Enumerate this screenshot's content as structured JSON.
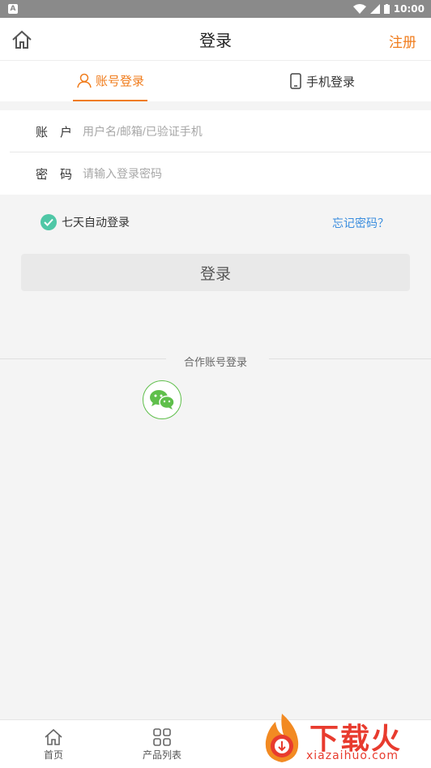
{
  "status_bar": {
    "time": "10:00"
  },
  "header": {
    "title": "登录",
    "register_label": "注册"
  },
  "tabs": [
    {
      "label": "账号登录",
      "active": true
    },
    {
      "label": "手机登录",
      "active": false
    }
  ],
  "form": {
    "account_label": "账　户",
    "account_placeholder": "用户名/邮箱/已验证手机",
    "account_value": "",
    "password_label": "密　码",
    "password_placeholder": "请输入登录密码",
    "password_value": ""
  },
  "remember": {
    "label": "七天自动登录",
    "checked": true
  },
  "forgot_label": "忘记密码？",
  "login_button": "登录",
  "partner_login_label": "合作账号登录",
  "bottom_nav": [
    {
      "label": "首页",
      "icon": "home-icon"
    },
    {
      "label": "产品列表",
      "icon": "grid-icon"
    }
  ],
  "watermark": {
    "text": "下载火",
    "url": "xiazaihuo.com"
  },
  "colors": {
    "accent": "#f07c1c",
    "link": "#3a8dde",
    "check": "#4fc7a6",
    "wechat": "#5fbf4b"
  }
}
